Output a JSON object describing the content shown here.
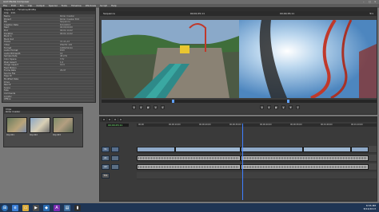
{
  "window": {
    "title": "Avid Media Composer",
    "controls": [
      "–",
      "□",
      "×"
    ]
  },
  "menu": [
    "File",
    "Edit",
    "Bin",
    "Clip",
    "Output",
    "Special",
    "Tools",
    "Timeline",
    "Windows",
    "Script",
    "Help"
  ],
  "inspector": {
    "title": "Inspector - Timeline/Profile",
    "tabs": [
      "Clip",
      "Info"
    ],
    "rows": [
      {
        "k": "Name",
        "v": "Roller Coaster"
      },
      {
        "k": "Project",
        "v": "Roller Coaster Edit"
      },
      {
        "k": "Bin",
        "v": "Sequence"
      },
      {
        "k": "Creation Date",
        "v": "8/14/2013"
      },
      {
        "k": "Start",
        "v": "00;00;00;00"
      },
      {
        "k": "End",
        "v": "00;01;14;22"
      },
      {
        "k": "Duration",
        "v": "00;01;14;22"
      },
      {
        "k": "Mark In",
        "v": ""
      },
      {
        "k": "Mark Out",
        "v": ""
      },
      {
        "k": "Tracks",
        "v": "V1 A1-A2"
      },
      {
        "k": "Video",
        "v": "DNxHD 145"
      },
      {
        "k": "Format",
        "v": "1080i/59.94"
      },
      {
        "k": "Audio Format",
        "v": "PCM"
      },
      {
        "k": "Audio Bit Depth",
        "v": "16"
      },
      {
        "k": "Sample Rate",
        "v": "48 kHz"
      },
      {
        "k": "Color Space",
        "v": "YUV"
      },
      {
        "k": "Pixel Aspect",
        "v": "1.0"
      },
      {
        "k": "Image Aspect",
        "v": "16:9"
      },
      {
        "k": "Field Motion",
        "v": ""
      },
      {
        "k": "Frame Rate",
        "v": "29.97"
      },
      {
        "k": "Source File",
        "v": ""
      },
      {
        "k": "Tape ID",
        "v": ""
      },
      {
        "k": "Modified Date",
        "v": ""
      },
      {
        "k": "Drive",
        "v": ""
      },
      {
        "k": "Reel #",
        "v": ""
      },
      {
        "k": "Scene",
        "v": ""
      },
      {
        "k": "Take",
        "v": ""
      },
      {
        "k": "Comments",
        "v": ""
      },
      {
        "k": "Locator",
        "v": ""
      },
      {
        "k": "Offline",
        "v": ""
      }
    ]
  },
  "bin": {
    "title": "Clips",
    "header": "Roller Coaster",
    "clips": [
      "Clip 001",
      "Clip 002",
      "Clip 003"
    ]
  },
  "composer": {
    "source_label": "Sequence",
    "source_tc": "00;00;45;11",
    "record_tc": "00;00;45;11",
    "record_label": "Tc1"
  },
  "timeline": {
    "timecode": "00;00;45;11",
    "ruler": [
      "00;00",
      "00;00;10;00",
      "00;00;20;00",
      "00;00;30;00",
      "00;00;40;00",
      "00;00;50;00",
      "00;01;00;00",
      "00;01;10;00"
    ],
    "tracks": [
      "V1",
      "A1",
      "A2",
      "TC1"
    ]
  },
  "taskbar": {
    "time": "8:55 PM",
    "date": "8/14/2013"
  }
}
